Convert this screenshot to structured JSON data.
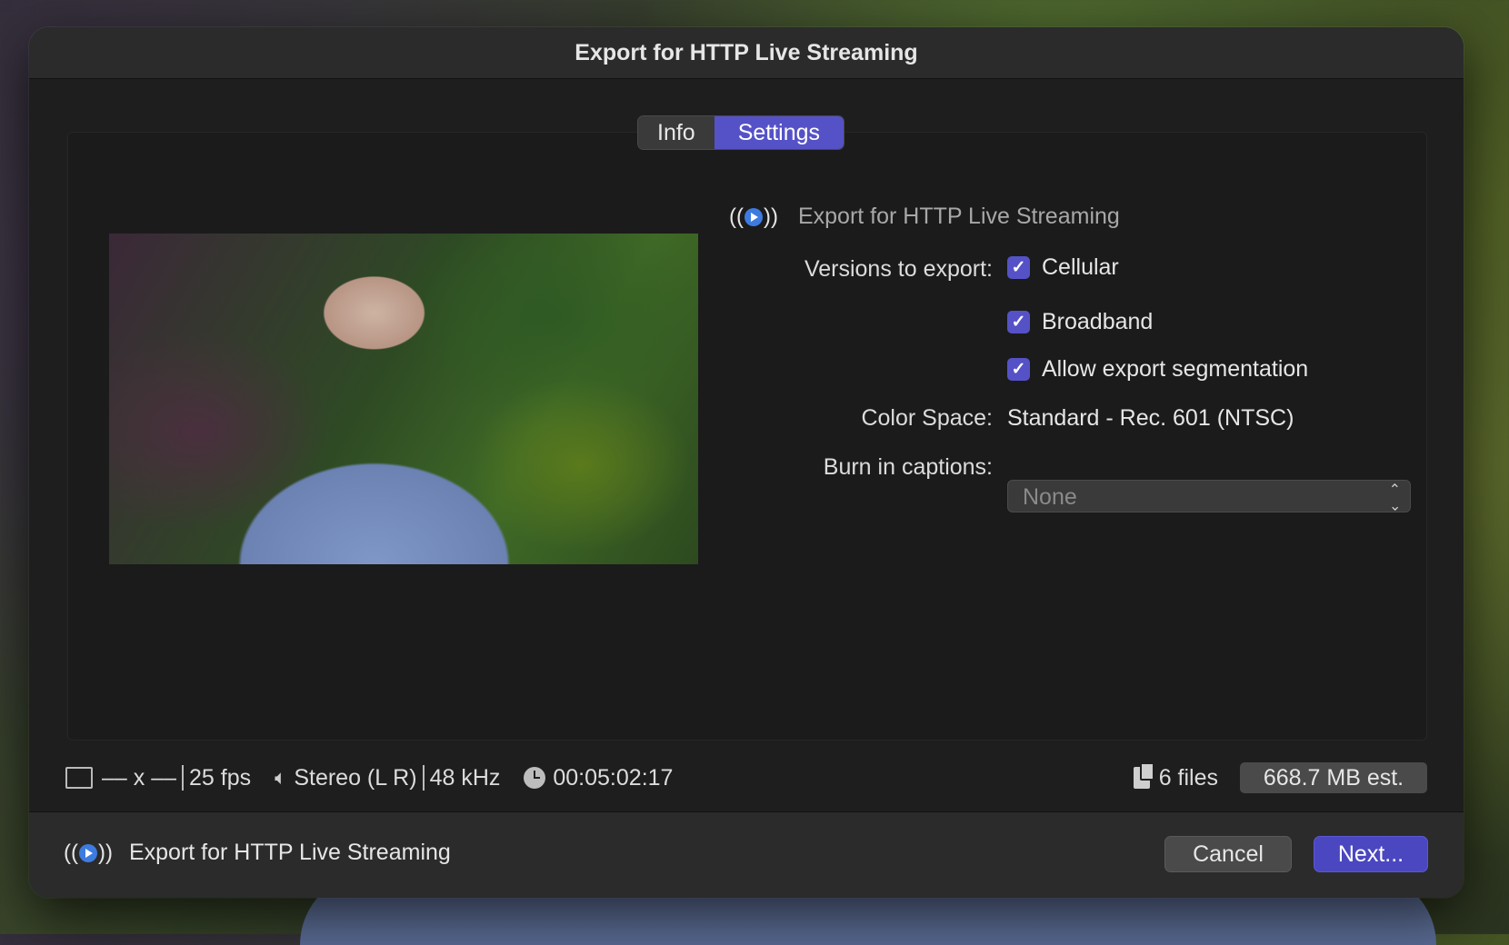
{
  "window": {
    "title": "Export for HTTP Live Streaming"
  },
  "tabs": [
    {
      "label": "Info",
      "active": false
    },
    {
      "label": "Settings",
      "active": true
    }
  ],
  "settings": {
    "heading": "Export for HTTP Live Streaming",
    "versions_label": "Versions to export:",
    "versions": [
      {
        "label": "Cellular",
        "checked": true
      },
      {
        "label": "Broadband",
        "checked": true
      },
      {
        "label": "Allow export segmentation",
        "checked": true
      }
    ],
    "color_space_label": "Color Space:",
    "color_space_value": "Standard - Rec. 601 (NTSC)",
    "captions_label": "Burn in captions:",
    "captions_value": "None"
  },
  "info_bar": {
    "dimensions": "–– x ––",
    "fps": "25 fps",
    "audio_channels": "Stereo (L R)",
    "sample_rate": "48 kHz",
    "duration": "00:05:02:17",
    "file_count": "6 files",
    "size_estimate": "668.7 MB est."
  },
  "footer": {
    "destination": "Export for HTTP Live Streaming",
    "cancel_label": "Cancel",
    "next_label": "Next..."
  },
  "colors": {
    "accent": "#5552c7",
    "hls_icon": "#3d7be0",
    "dialog_bg": "#1e1e1e"
  },
  "icons": {
    "hls": "broadcast-play-icon",
    "frame": "frame-size-icon",
    "speaker": "speaker-icon",
    "clock": "clock-icon",
    "files": "document-stack-icon",
    "popup": "up-down-chevron-icon",
    "checkbox": "checkmark-icon"
  }
}
